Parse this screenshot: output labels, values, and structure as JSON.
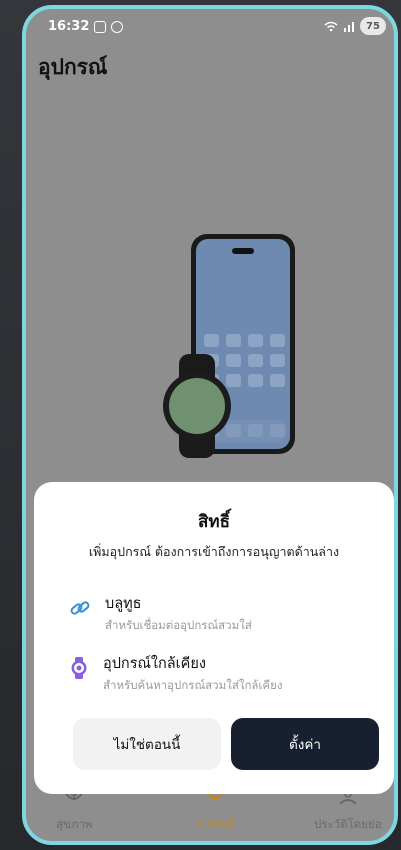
{
  "status_bar": {
    "time": "16:32",
    "battery_level": "75",
    "icons": [
      "screenshot-icon",
      "notification-icon",
      "wifi-icon",
      "signal-icon"
    ]
  },
  "page": {
    "title": "อุปกรณ์"
  },
  "permission_sheet": {
    "title": "สิทธิ์",
    "subtitle": "เพิ่มอุปกรณ์ ต้องการเข้าถึงการอนุญาตด้านล่าง",
    "items": [
      {
        "icon": "link-icon",
        "title": "บลูทูธ",
        "description": "สำหรับเชื่อมต่ออุปกรณ์สวมใส่"
      },
      {
        "icon": "watch-icon",
        "title": "อุปกรณ์ใกล้เคียง",
        "description": "สำหรับค้นหาอุปกรณ์สวมใส่ใกล้เคียง"
      }
    ],
    "not_now_label": "ไม่ใช่ตอนนี้",
    "settings_label": "ตั้งค่า"
  },
  "bottom_nav": {
    "items": [
      {
        "label": "สุขภาพ",
        "icon": "health-icon",
        "active": false
      },
      {
        "label": "อุปกรณ์",
        "icon": "device-icon",
        "active": true
      },
      {
        "label": "ประวัติโดยย่อ",
        "icon": "profile-icon",
        "active": false
      }
    ]
  },
  "colors": {
    "frame": "#7dd6e0",
    "overlay": "#8e8e8e",
    "primary_button": "#172030",
    "active_nav": "#c8860f",
    "link_icon": "#2f8fd8",
    "watch_icon": "#8a5ee0"
  }
}
